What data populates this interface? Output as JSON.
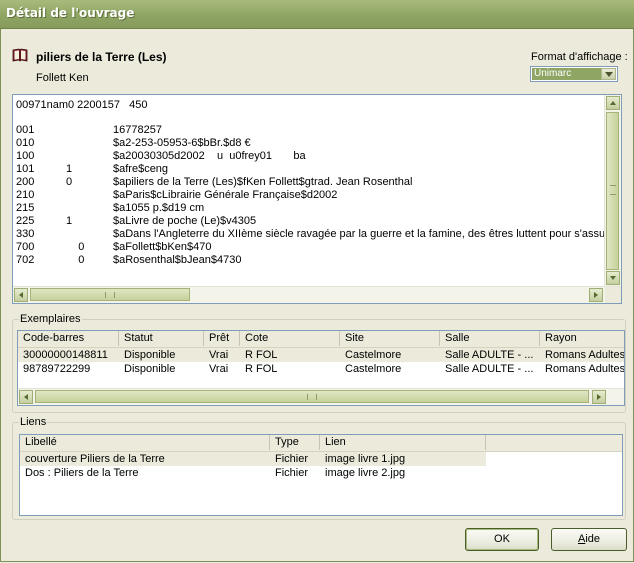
{
  "window": {
    "title": "Détail de l'ouvrage"
  },
  "work": {
    "title": "piliers de la Terre (Les)",
    "author": "Follett Ken",
    "icon": "book-icon"
  },
  "format": {
    "label": "Format d'affichage :",
    "value": "Unimarc"
  },
  "marc": {
    "header": "00971nam0 2200157   450",
    "lines": [
      {
        "tag": "001",
        "ind": "",
        "text": "16778257"
      },
      {
        "tag": "010",
        "ind": "",
        "text": "$a2-253-05953-6$bBr.$d8 €"
      },
      {
        "tag": "100",
        "ind": "",
        "text": "$a20030305d2002    u  u0frey01       ba"
      },
      {
        "tag": "101",
        "ind": "1",
        "text": "$afre$ceng"
      },
      {
        "tag": "200",
        "ind": "0",
        "text": "$apiliers de la Terre (Les)$fKen Follett$gtrad. Jean Rosenthal"
      },
      {
        "tag": "210",
        "ind": "",
        "text": "$aParis$cLibrairie Générale Française$d2002"
      },
      {
        "tag": "215",
        "ind": "",
        "text": "$a1055 p.$d19 cm"
      },
      {
        "tag": "225",
        "ind": "1",
        "text": "$aLivre de poche (Le)$v4305"
      },
      {
        "tag": "330",
        "ind": "",
        "text": "$aDans l'Angleterre du XIIème siècle ravagée par la guerre et la famine, des êtres luttent pour s'assurer le"
      },
      {
        "tag": "700",
        "ind": "    0",
        "text": "$aFollett$bKen$470"
      },
      {
        "tag": "702",
        "ind": "    0",
        "text": "$aRosenthal$bJean$4730"
      }
    ]
  },
  "exemplaires": {
    "label": "Exemplaires",
    "columns": [
      "Code-barres",
      "Statut",
      "Prêt",
      "Cote",
      "Site",
      "Salle",
      "Rayon"
    ],
    "rows": [
      [
        "30000000148811",
        "Disponible",
        "Vrai",
        "R FOL",
        "Castelmore",
        "Salle ADULTE - ...",
        "Romans Adultes"
      ],
      [
        "98789722299",
        "Disponible",
        "Vrai",
        "R FOL",
        "Castelmore",
        "Salle ADULTE - ...",
        "Romans Adultes"
      ]
    ]
  },
  "liens": {
    "label": "Liens",
    "columns": [
      "Libellé",
      "Type",
      "Lien"
    ],
    "rows": [
      [
        "couverture Piliers de la Terre",
        "Fichier",
        "image livre 1.jpg"
      ],
      [
        "Dos : Piliers de la Terre",
        "Fichier",
        "image livre 2.jpg"
      ]
    ]
  },
  "buttons": {
    "ok": "OK",
    "aide_first": "A",
    "aide_rest": "ide"
  },
  "colors": {
    "titlebar": "#8fa564",
    "selection": "#8fa564",
    "window_bg": "#ecebdb"
  }
}
